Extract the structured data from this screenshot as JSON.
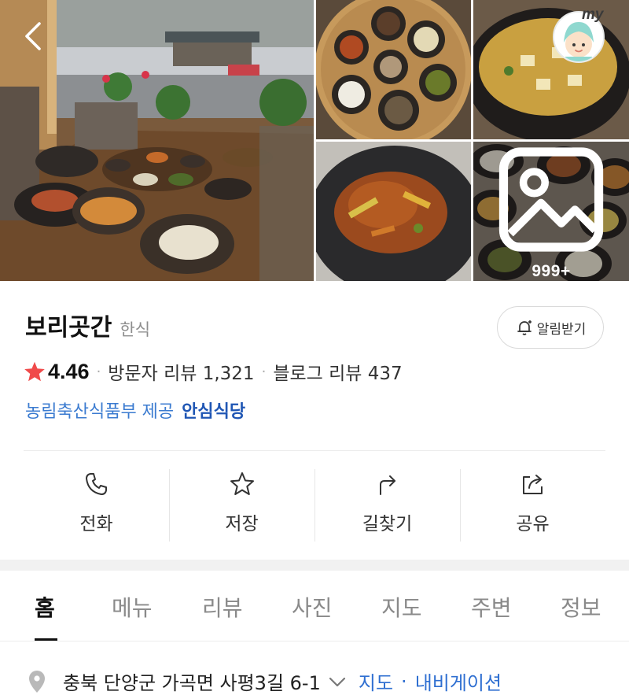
{
  "gallery": {
    "photos": [
      {
        "icon": "restaurant-table-photo"
      },
      {
        "icon": "side-dishes-photo"
      },
      {
        "icon": "stew-photo"
      },
      {
        "icon": "bulgogi-photo"
      },
      {
        "icon": "more-photos"
      }
    ],
    "more_count": "999+"
  },
  "header": {
    "back_icon": "chevron-left-icon",
    "my_label": "my"
  },
  "place": {
    "name": "보리곳간",
    "category": "한식",
    "alarm_label": "알림받기",
    "rating": "4.46",
    "visitor_reviews": "방문자 리뷰 1,321",
    "blog_reviews": "블로그 리뷰 437",
    "provider": "농림축산식품부 제공",
    "badge": "안심식당",
    "colors": {
      "star": "#f04a4a",
      "link": "#2f6fd1",
      "badge": "#1f56b4"
    }
  },
  "actions": [
    {
      "label": "전화",
      "icon": "phone-icon"
    },
    {
      "label": "저장",
      "icon": "star-outline-icon"
    },
    {
      "label": "길찾기",
      "icon": "directions-icon"
    },
    {
      "label": "공유",
      "icon": "share-icon"
    }
  ],
  "tabs": [
    {
      "label": "홈",
      "active": true
    },
    {
      "label": "메뉴",
      "active": false
    },
    {
      "label": "리뷰",
      "active": false
    },
    {
      "label": "사진",
      "active": false
    },
    {
      "label": "지도",
      "active": false
    },
    {
      "label": "주변",
      "active": false
    },
    {
      "label": "정보",
      "active": false
    }
  ],
  "address": {
    "text": "충북 단양군 가곡면 사평3길 6-1",
    "map_link": "지도",
    "separator": "·",
    "nav_link": "내비게이션"
  }
}
